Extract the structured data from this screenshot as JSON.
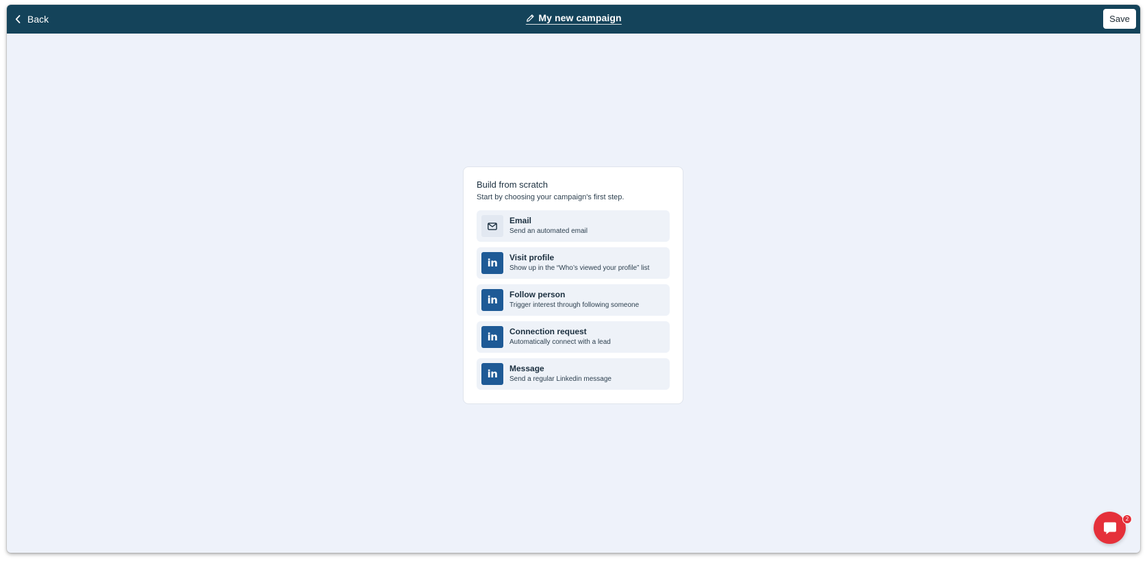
{
  "topbar": {
    "back_label": "Back",
    "campaign_title": "My new campaign",
    "save_label": "Save",
    "background_color": "#14435a"
  },
  "card": {
    "title": "Build from scratch",
    "subtitle": "Start by choosing your campaign's first step.",
    "options": [
      {
        "icon": "email-icon",
        "label": "Email",
        "description": "Send an automated email"
      },
      {
        "icon": "linkedin-icon",
        "icon_text": "in",
        "label": "Visit profile",
        "description": "Show up in the “Who’s viewed your profile” list"
      },
      {
        "icon": "linkedin-icon",
        "icon_text": "in",
        "label": "Follow person",
        "description": "Trigger interest through following someone"
      },
      {
        "icon": "linkedin-icon",
        "icon_text": "in",
        "label": "Connection request",
        "description": "Automatically connect with a lead"
      },
      {
        "icon": "linkedin-icon",
        "icon_text": "in",
        "label": "Message",
        "description": "Send a regular Linkedin message"
      }
    ]
  },
  "chat": {
    "icon": "chat-bubble-icon",
    "badge_count": "2",
    "color": "#e5303a"
  },
  "colors": {
    "canvas_background": "#eef2fa",
    "linkedin_blue": "#1e5a96"
  }
}
